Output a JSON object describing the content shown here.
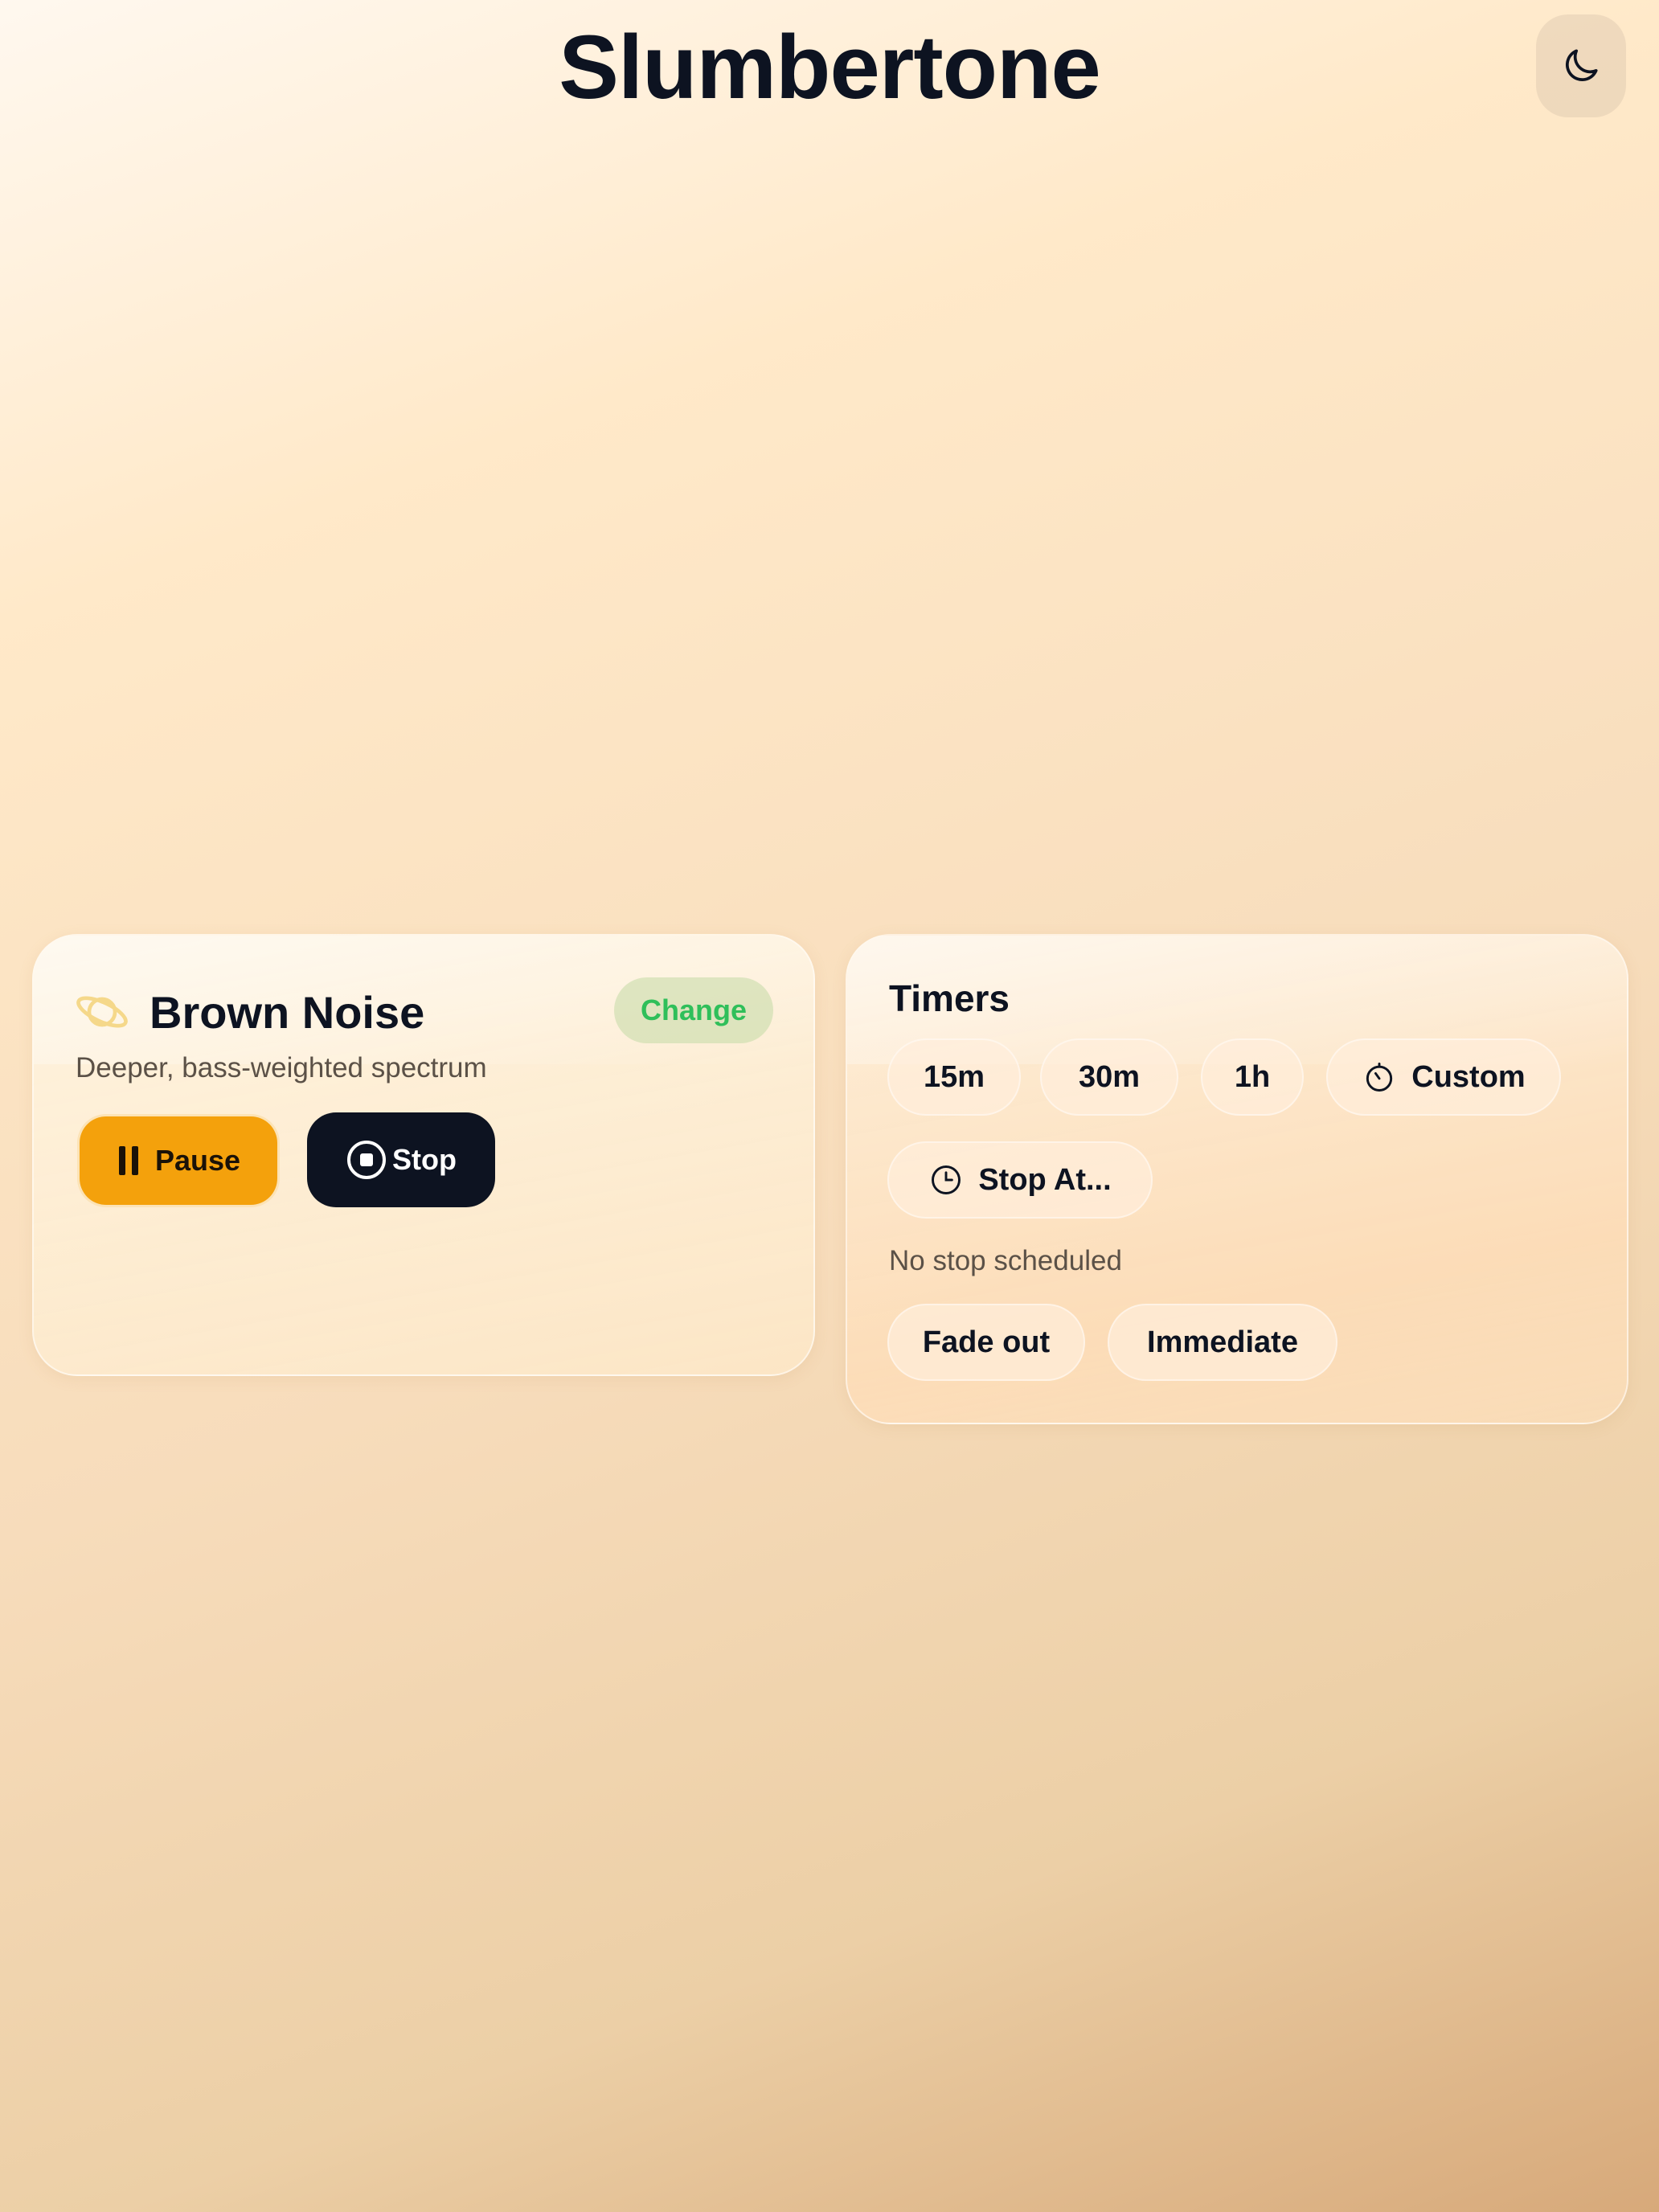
{
  "app": {
    "title": "Slumbertone",
    "theme_icon": "moon-icon"
  },
  "now_playing": {
    "icon": "planet-icon",
    "sound_name": "Brown Noise",
    "change_label": "Change",
    "description": "Deeper, bass-weighted spectrum",
    "pause_label": "Pause",
    "stop_label": "Stop",
    "colors": {
      "pause": "#f4a10c",
      "stop": "#0d1321",
      "change_text": "#2fbf5a"
    }
  },
  "timers": {
    "title": "Timers",
    "presets": [
      {
        "label": "15m"
      },
      {
        "label": "30m"
      },
      {
        "label": "1h"
      }
    ],
    "custom_label": "Custom",
    "stop_at_label": "Stop At...",
    "status": "No stop scheduled",
    "fade_out_label": "Fade out",
    "immediate_label": "Immediate"
  }
}
